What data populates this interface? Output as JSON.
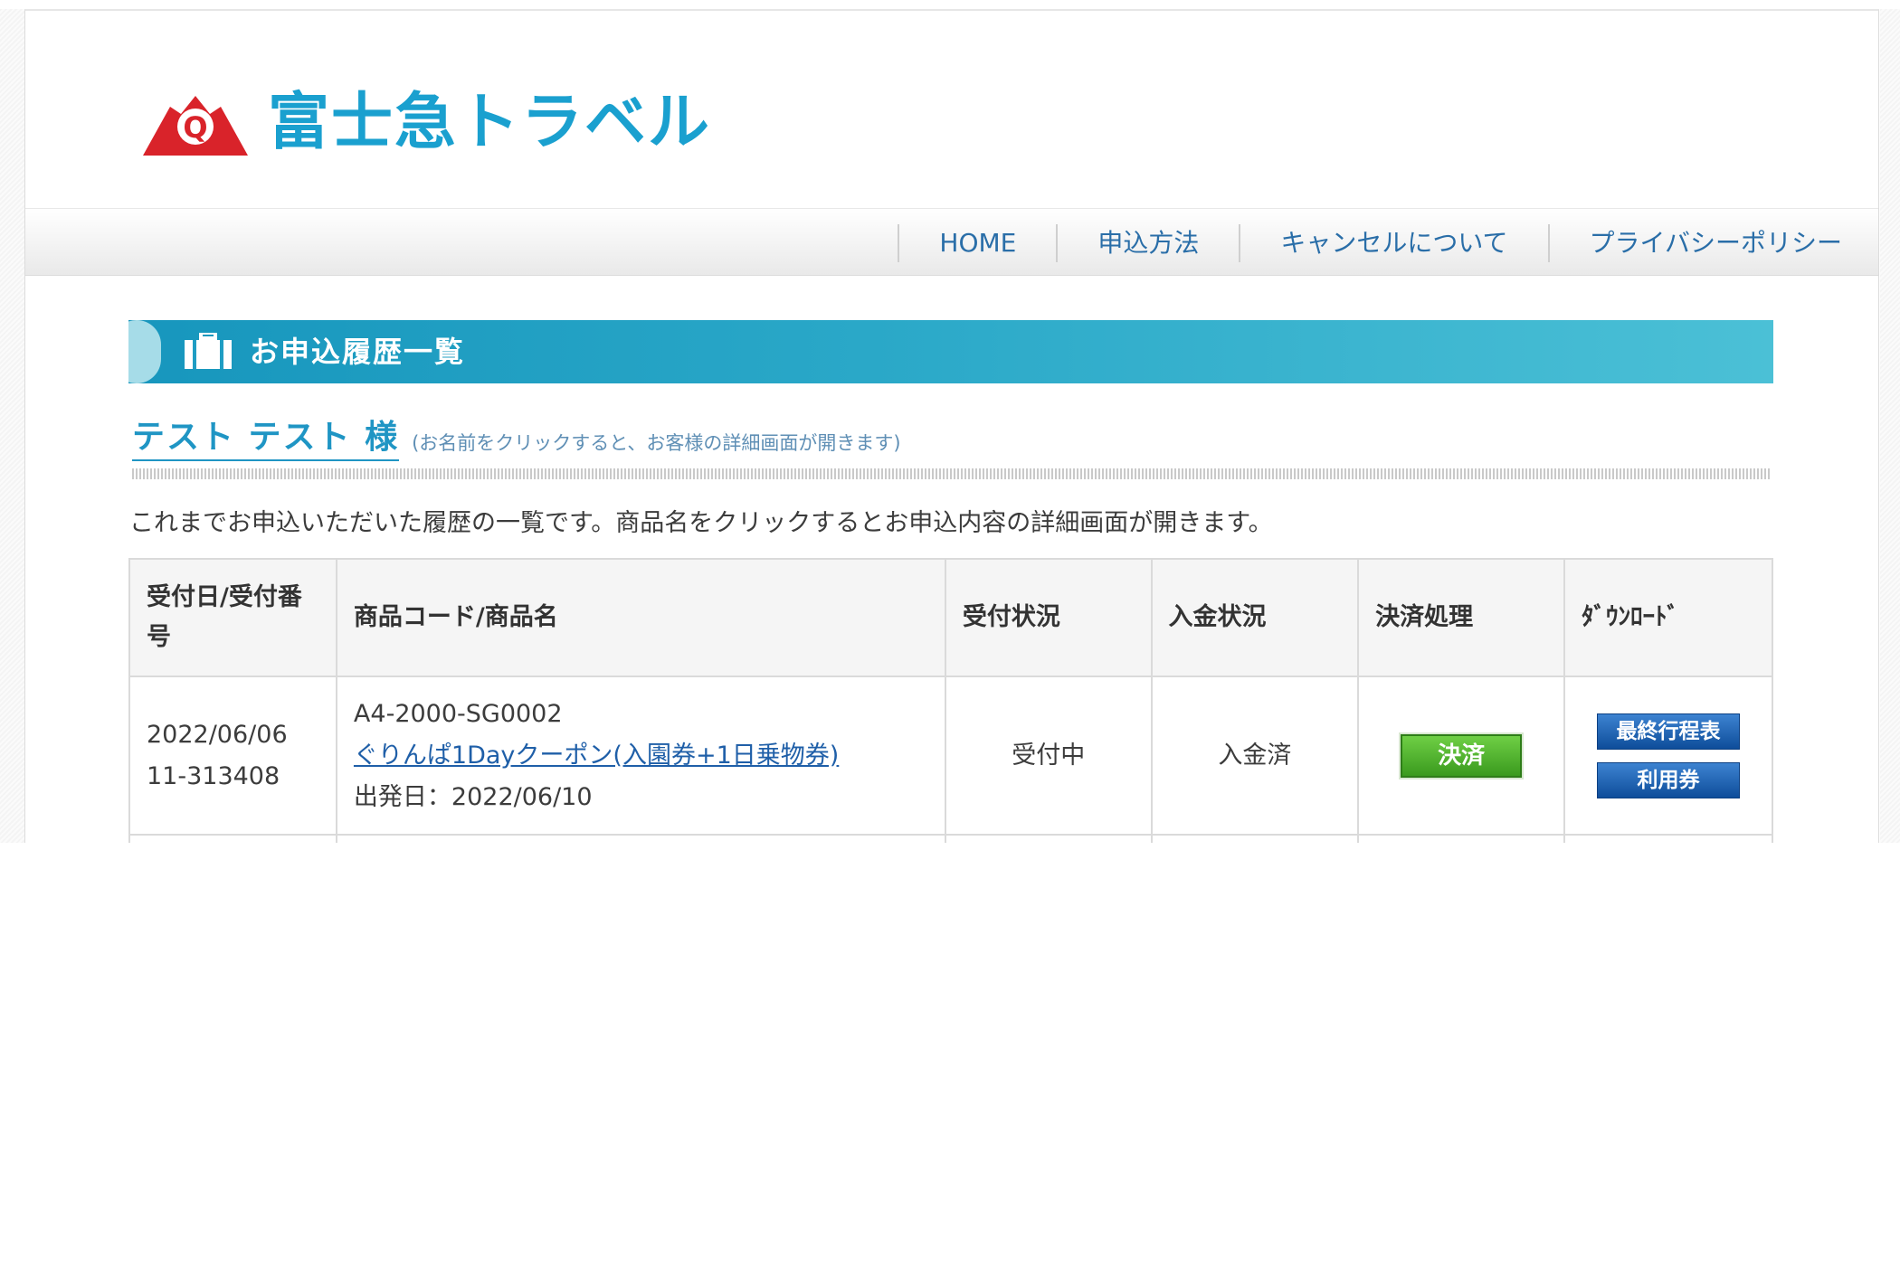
{
  "brand": {
    "logo_text": "富士急トラベル",
    "logo_mark": "Q",
    "colors": {
      "brand_blue": "#1aa0cf",
      "logo_red": "#d9232a"
    }
  },
  "nav": {
    "items": [
      {
        "label": "HOME"
      },
      {
        "label": "申込方法"
      },
      {
        "label": "キャンセルについて"
      },
      {
        "label": "プライバシーポリシー"
      }
    ]
  },
  "section": {
    "title": "お申込履歴一覧",
    "icon": "briefcase-icon"
  },
  "customer": {
    "name": "テスト テスト 様",
    "note": "(お名前をクリックすると、お客様の詳細画面が開きます)"
  },
  "description": "これまでお申込いただいた履歴の一覧です。商品名をクリックするとお申込内容の詳細画面が開きます。",
  "table": {
    "headers": {
      "date_number": "受付日/受付番号",
      "product": "商品コード/商品名",
      "reception": "受付状況",
      "payment": "入金状況",
      "settlement": "決済処理",
      "download": "ﾀﾞｳﾝﾛｰﾄﾞ"
    },
    "rows": [
      {
        "date": "2022/06/06",
        "number": "11-313408",
        "product_code": "A4-2000-SG0002",
        "product_name": "ぐりんぱ1Dayクーポン(入園券+1日乗物券)",
        "departure": "出発日：2022/06/10",
        "reception_status": "受付中",
        "payment_status": "入金済",
        "settle_button": "決済",
        "download_buttons": [
          "最終行程表",
          "利用券"
        ]
      }
    ]
  }
}
